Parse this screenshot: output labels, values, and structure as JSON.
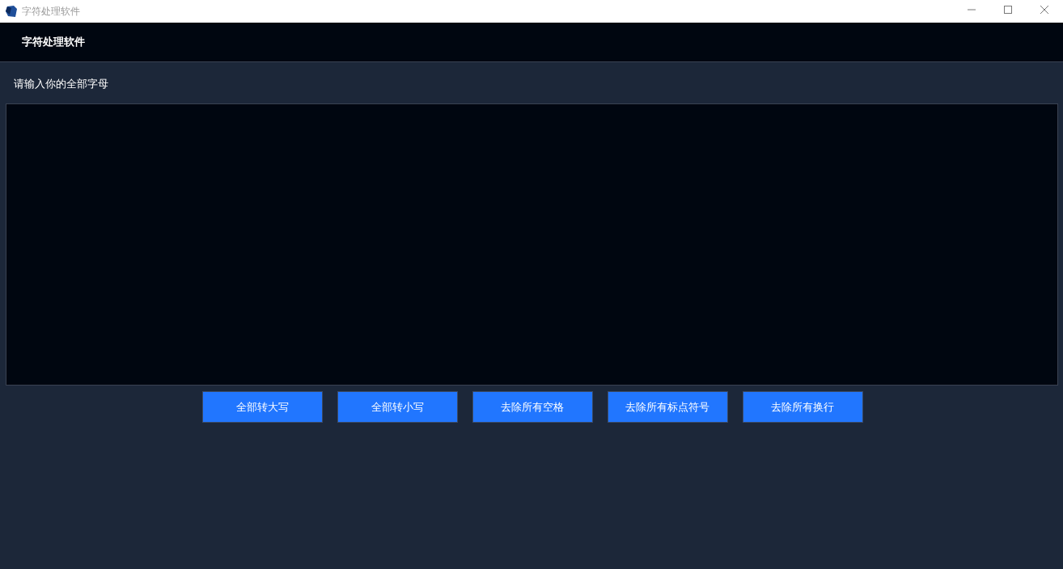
{
  "window": {
    "title": "字符处理软件"
  },
  "header": {
    "title": "字符处理软件"
  },
  "input": {
    "label": "请输入你的全部字母"
  },
  "buttons": [
    {
      "label": "全部转大写"
    },
    {
      "label": "全部转小写"
    },
    {
      "label": "去除所有空格"
    },
    {
      "label": "去除所有标点符号"
    },
    {
      "label": "去除所有换行"
    }
  ]
}
